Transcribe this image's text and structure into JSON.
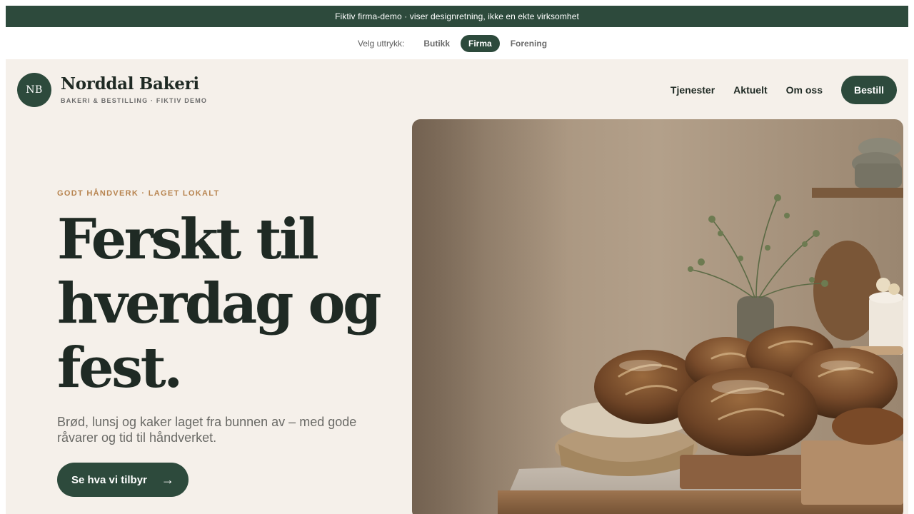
{
  "banner": {
    "text": "Fiktiv firma-demo · viser designretning, ikke en ekte virksomhet"
  },
  "style_switcher": {
    "label": "Velg uttrykk:",
    "options": [
      "Butikk",
      "Firma",
      "Forening"
    ],
    "selected": "Firma"
  },
  "header": {
    "logo_initials": "NB",
    "brand_name": "Norddal Bakeri",
    "brand_tagline": "BAKERI & BESTILLING · FIKTIV DEMO",
    "nav": [
      "Tjenester",
      "Aktuelt",
      "Om oss"
    ],
    "cta": "Bestill"
  },
  "hero": {
    "eyebrow": "GODT HÅNDVERK · LAGET LOKALT",
    "headline_lines": [
      "Ferskt til",
      "hverdag og",
      "fest."
    ],
    "lede": "Brød, lunsj og kaker laget fra bunnen av – med gode råvarer og tid til håndverket.",
    "button_label": "Se hva vi tilbyr",
    "button_arrow": "→"
  },
  "colors": {
    "brand_green": "#2d4a3c",
    "page_bg": "#f5f0ea",
    "accent": "#b7834e",
    "text_dark": "#1f2a24"
  }
}
